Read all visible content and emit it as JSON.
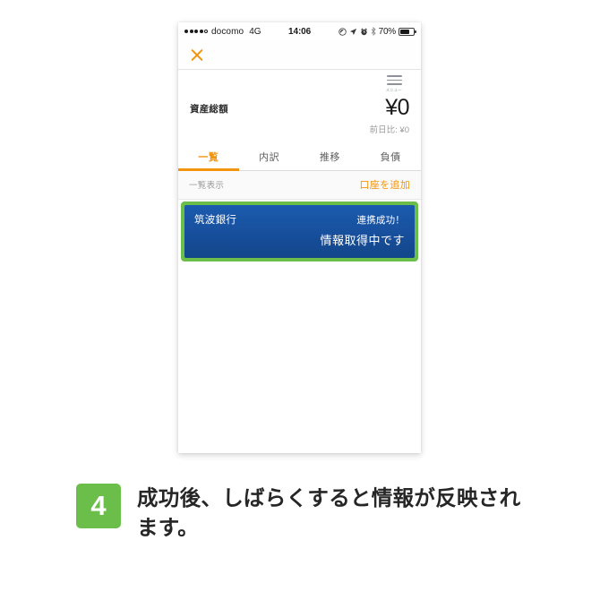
{
  "phone": {
    "status_bar": {
      "carrier": "docomo",
      "network": "4G",
      "time": "14:06",
      "battery_percent": "70%",
      "icons": [
        "do-not-disturb-icon",
        "location-arrow-icon",
        "alarm-clock-icon",
        "bluetooth-icon",
        "battery-icon"
      ]
    },
    "navbar": {
      "close_icon": "close-x-icon"
    },
    "summary": {
      "menu_label": "メニュー",
      "menu_icon": "hamburger-menu-icon",
      "total_label": "資産総額",
      "total_amount": "¥0",
      "delta_label": "前日比: ¥0"
    },
    "tabs": [
      {
        "label": "一覧",
        "active": true
      },
      {
        "label": "内訳",
        "active": false
      },
      {
        "label": "推移",
        "active": false
      },
      {
        "label": "負債",
        "active": false
      }
    ],
    "subbar": {
      "view_label": "一覧表示",
      "add_account_label": "口座を追加"
    },
    "bank_card": {
      "bank_name": "筑波銀行",
      "status": "連携成功！",
      "message": "情報取得中です"
    }
  },
  "caption": {
    "step_number": "4",
    "text": "成功後、しばらくすると情報が反映されます。"
  },
  "colors": {
    "accent_orange": "#f2940d",
    "highlight_green": "#6cbe4b",
    "card_blue": "#1b5bae",
    "page_background": "#ffffff"
  }
}
